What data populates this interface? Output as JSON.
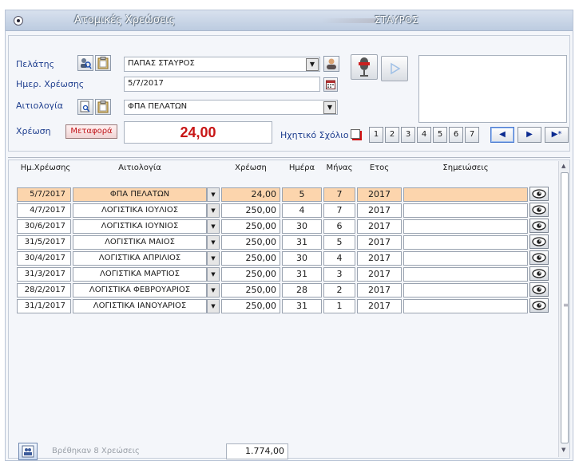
{
  "window": {
    "title": "Ατομικές Χρεώσεις",
    "user": "ΣΤΑΥΡΟΣ"
  },
  "form": {
    "customer_label": "Πελάτης",
    "customer_value": "ΠΑΠΑΣ ΣΤΑΥΡΟΣ",
    "date_label": "Ημερ. Χρέωσης",
    "date_value": "5/7/2017",
    "reason_label": "Αιτιολογία",
    "reason_value": "ΦΠΑ ΠΕΛΑΤΩΝ",
    "charge_label": "Χρέωση",
    "transfer_button": "Μεταφορά",
    "amount": "24,00",
    "audio_comment_label": "Ηχητικό Σχόλιο",
    "page_buttons": [
      "1",
      "2",
      "3",
      "4",
      "5",
      "6",
      "7"
    ],
    "nav_buttons": [
      "◀",
      "▶",
      "▶*"
    ]
  },
  "grid": {
    "columns": [
      "Ημ.Χρέωσης",
      "Αιτιολογία",
      "Χρέωση",
      "Ημέρα",
      "Μήνας",
      "Ετος",
      "Σημειώσεις"
    ],
    "rows": [
      {
        "date": "5/7/2017",
        "reason": "ΦΠΑ ΠΕΛΑΤΩΝ",
        "amount": "24,00",
        "day": "5",
        "month": "7",
        "year": "2017",
        "notes": "",
        "selected": true
      },
      {
        "date": "4/7/2017",
        "reason": "ΛΟΓΙΣΤΙΚΑ ΙΟΥΛΙΟΣ",
        "amount": "250,00",
        "day": "4",
        "month": "7",
        "year": "2017",
        "notes": "",
        "selected": false
      },
      {
        "date": "30/6/2017",
        "reason": "ΛΟΓΙΣΤΙΚΑ ΙΟΥΝΙΟΣ",
        "amount": "250,00",
        "day": "30",
        "month": "6",
        "year": "2017",
        "notes": "",
        "selected": false
      },
      {
        "date": "31/5/2017",
        "reason": "ΛΟΓΙΣΤΙΚΑ ΜΑΙΟΣ",
        "amount": "250,00",
        "day": "31",
        "month": "5",
        "year": "2017",
        "notes": "",
        "selected": false
      },
      {
        "date": "30/4/2017",
        "reason": "ΛΟΓΙΣΤΙΚΑ ΑΠΡΙΛΙΟΣ",
        "amount": "250,00",
        "day": "30",
        "month": "4",
        "year": "2017",
        "notes": "",
        "selected": false
      },
      {
        "date": "31/3/2017",
        "reason": "ΛΟΓΙΣΤΙΚΑ ΜΑΡΤΙΟΣ",
        "amount": "250,00",
        "day": "31",
        "month": "3",
        "year": "2017",
        "notes": "",
        "selected": false
      },
      {
        "date": "28/2/2017",
        "reason": "ΛΟΓΙΣΤΙΚΑ ΦΕΒΡΟΥΑΡΙΟΣ",
        "amount": "250,00",
        "day": "28",
        "month": "2",
        "year": "2017",
        "notes": "",
        "selected": false
      },
      {
        "date": "31/1/2017",
        "reason": "ΛΟΓΙΣΤΙΚΑ ΙΑΝΟΥΑΡΙΟΣ",
        "amount": "250,00",
        "day": "31",
        "month": "1",
        "year": "2017",
        "notes": "",
        "selected": false
      }
    ]
  },
  "footer": {
    "found_text": "Βρέθηκαν 8 Χρεώσεις",
    "total": "1.774,00"
  },
  "colors": {
    "selected_row": "#fcd5ad",
    "amount_text": "#c81616",
    "label_text": "#1f3f8f"
  }
}
